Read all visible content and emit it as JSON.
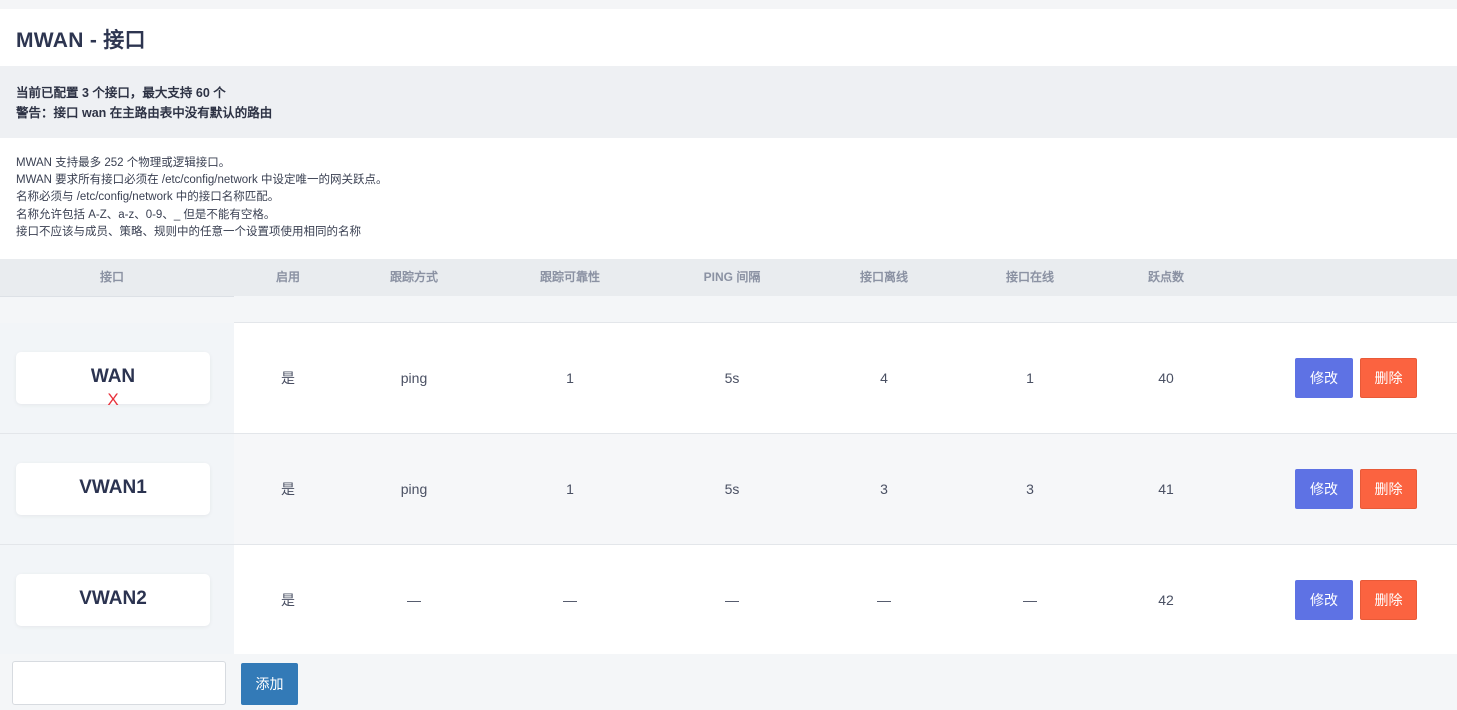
{
  "page": {
    "title": "MWAN - 接口"
  },
  "alert": {
    "line1": "当前已配置 3 个接口，最大支持 60 个",
    "line2": "警告：接口 wan 在主路由表中没有默认的路由"
  },
  "description": {
    "lines": [
      "MWAN 支持最多 252 个物理或逻辑接口。",
      "MWAN 要求所有接口必须在 /etc/config/network 中设定唯一的网关跃点。",
      "名称必须与 /etc/config/network 中的接口名称匹配。",
      "名称允许包括 A-Z、a-z、0-9、_ 但是不能有空格。",
      "接口不应该与成员、策略、规则中的任意一个设置项使用相同的名称"
    ]
  },
  "table": {
    "headers": [
      "接口",
      "启用",
      "跟踪方式",
      "跟踪可靠性",
      "PING 间隔",
      "接口离线",
      "接口在线",
      "跃点数"
    ],
    "rows": [
      {
        "name": "WAN",
        "status_mark": "X",
        "enabled": "是",
        "track_method": "ping",
        "reliability": "1",
        "ping_interval": "5s",
        "down": "4",
        "up": "1",
        "metric": "40",
        "edit_label": "修改",
        "delete_label": "删除"
      },
      {
        "name": "VWAN1",
        "status_mark": "",
        "enabled": "是",
        "track_method": "ping",
        "reliability": "1",
        "ping_interval": "5s",
        "down": "3",
        "up": "3",
        "metric": "41",
        "edit_label": "修改",
        "delete_label": "删除"
      },
      {
        "name": "VWAN2",
        "status_mark": "",
        "enabled": "是",
        "track_method": "—",
        "reliability": "—",
        "ping_interval": "—",
        "down": "—",
        "up": "—",
        "metric": "42",
        "edit_label": "修改",
        "delete_label": "删除"
      }
    ]
  },
  "add": {
    "input_value": "",
    "button_label": "添加"
  },
  "colors": {
    "edit": "#5e72e4",
    "delete": "#fb6340",
    "add": "#337ab7",
    "offline_mark": "#e8323c"
  }
}
